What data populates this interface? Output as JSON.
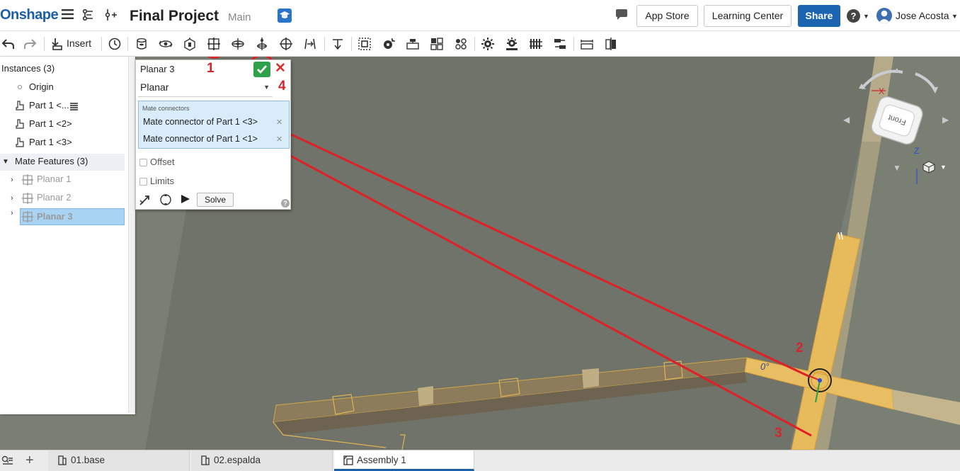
{
  "header": {
    "logo": "Onshape",
    "doc_title": "Final Project",
    "branch": "Main",
    "app_store": "App Store",
    "learning_center": "Learning Center",
    "share": "Share",
    "user_name": "Jose Acosta"
  },
  "toolbar": {
    "insert_label": "Insert"
  },
  "left_panel": {
    "instances_header": "Instances (3)",
    "instances": [
      "Origin",
      "Part 1 <...",
      "Part 1 <2>",
      "Part 1 <3>"
    ],
    "mate_features_header": "Mate Features (3)",
    "mate_features": [
      "Planar 1",
      "Planar 2",
      "Planar 3"
    ]
  },
  "mate_dialog": {
    "title": "Planar 3",
    "mate_type": "Planar",
    "connectors_header": "Mate connectors",
    "connectors": [
      "Mate connector of Part 1 <3>",
      "Mate connector of Part 1 <1>"
    ],
    "offset_label": "Offset",
    "limits_label": "Limits",
    "solve_label": "Solve"
  },
  "viewport": {
    "angle_label": "0°",
    "viewcube_face": "Front",
    "axis_x": "X",
    "axis_z": "Z"
  },
  "annotations": [
    "1",
    "2",
    "3",
    "4"
  ],
  "bottom_tabs": [
    "01.base",
    "02.espalda",
    "Assembly 1"
  ],
  "colors": {
    "brand": "#1d5fa8",
    "accept": "#2ea24a",
    "annotation": "#d6242b",
    "part": "#e8b95a",
    "viewport": "#7a7f74"
  }
}
